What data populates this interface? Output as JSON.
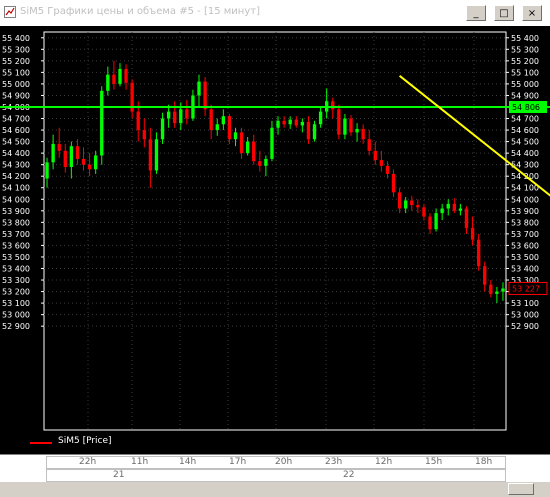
{
  "window": {
    "title": "SiM5 Графики цены и объема #5 - [15 минут]",
    "minimize_label": "_",
    "maximize_label": "□",
    "close_label": "×"
  },
  "chart_data": {
    "type": "candlestick",
    "instrument": "SiM5",
    "timeframe": "15 минут",
    "ylim": [
      52000,
      55450
    ],
    "y_ticks": [
      55400,
      55300,
      55200,
      55100,
      55000,
      54900,
      54800,
      54700,
      54600,
      54500,
      54400,
      54300,
      54200,
      54100,
      54000,
      53900,
      53800,
      53700,
      53600,
      53500,
      53400,
      53300,
      53200,
      53100,
      53000,
      52900
    ],
    "left_tick_labels": [
      "55 400",
      "55 300",
      "55 200",
      "55 100",
      "55 000",
      "54 900",
      "54 800",
      "54 700",
      "54 600",
      "54 500",
      "54 400",
      "54 300",
      "54 200",
      "54 100",
      "54 000",
      "53 900",
      "53 800",
      "53 700",
      "53 600",
      "53 500",
      "53 400",
      "53 300",
      "53 200",
      "53 100",
      "53 000",
      "52 900"
    ],
    "right_tick_labels": [
      "55 400",
      "55 300",
      "55 200",
      "55 100",
      "55 000",
      "54 900",
      "",
      "54 700",
      "54 600",
      "54 500",
      "54 400",
      "54 300",
      "54 200",
      "54 100",
      "54 000",
      "53 900",
      "53 800",
      "53 700",
      "53 600",
      "53 500",
      "53 400",
      "53 300",
      "",
      "53 100",
      "53 000",
      "52 900"
    ],
    "horizontal_level": {
      "value": 54800,
      "label": "54 806",
      "color": "#00ff00"
    },
    "last_price": {
      "value": 53227,
      "label": "53 227",
      "color": "#ff0000"
    },
    "trendline": {
      "from_index": 58,
      "from_value": 55070,
      "to_index": 90,
      "to_value": 53730,
      "color": "#ffff00"
    },
    "candles": [
      {
        "o": 54180,
        "h": 54360,
        "l": 54100,
        "c": 54320
      },
      {
        "o": 54320,
        "h": 54560,
        "l": 54260,
        "c": 54480
      },
      {
        "o": 54480,
        "h": 54620,
        "l": 54360,
        "c": 54420
      },
      {
        "o": 54420,
        "h": 54480,
        "l": 54230,
        "c": 54280
      },
      {
        "o": 54280,
        "h": 54500,
        "l": 54180,
        "c": 54460
      },
      {
        "o": 54460,
        "h": 54520,
        "l": 54300,
        "c": 54350
      },
      {
        "o": 54350,
        "h": 54450,
        "l": 54250,
        "c": 54300
      },
      {
        "o": 54300,
        "h": 54400,
        "l": 54200,
        "c": 54260
      },
      {
        "o": 54260,
        "h": 54420,
        "l": 54220,
        "c": 54380
      },
      {
        "o": 54380,
        "h": 54980,
        "l": 54300,
        "c": 54940
      },
      {
        "o": 54940,
        "h": 55150,
        "l": 54900,
        "c": 55080
      },
      {
        "o": 55080,
        "h": 55200,
        "l": 54950,
        "c": 55000
      },
      {
        "o": 55000,
        "h": 55180,
        "l": 54980,
        "c": 55130
      },
      {
        "o": 55130,
        "h": 55170,
        "l": 54950,
        "c": 55010
      },
      {
        "o": 55010,
        "h": 55040,
        "l": 54700,
        "c": 54760
      },
      {
        "o": 54760,
        "h": 54850,
        "l": 54500,
        "c": 54600
      },
      {
        "o": 54600,
        "h": 54700,
        "l": 54450,
        "c": 54520
      },
      {
        "o": 54520,
        "h": 54620,
        "l": 54100,
        "c": 54250
      },
      {
        "o": 54250,
        "h": 54580,
        "l": 54220,
        "c": 54520
      },
      {
        "o": 54520,
        "h": 54750,
        "l": 54480,
        "c": 54700
      },
      {
        "o": 54700,
        "h": 54820,
        "l": 54620,
        "c": 54760
      },
      {
        "o": 54760,
        "h": 54850,
        "l": 54620,
        "c": 54660
      },
      {
        "o": 54660,
        "h": 54840,
        "l": 54600,
        "c": 54780
      },
      {
        "o": 54780,
        "h": 54860,
        "l": 54650,
        "c": 54700
      },
      {
        "o": 54700,
        "h": 54950,
        "l": 54680,
        "c": 54900
      },
      {
        "o": 54900,
        "h": 55080,
        "l": 54800,
        "c": 55020
      },
      {
        "o": 55020,
        "h": 55060,
        "l": 54720,
        "c": 54780
      },
      {
        "o": 54780,
        "h": 54820,
        "l": 54520,
        "c": 54600
      },
      {
        "o": 54600,
        "h": 54700,
        "l": 54550,
        "c": 54650
      },
      {
        "o": 54650,
        "h": 54780,
        "l": 54600,
        "c": 54720
      },
      {
        "o": 54720,
        "h": 54740,
        "l": 54480,
        "c": 54520
      },
      {
        "o": 54520,
        "h": 54620,
        "l": 54460,
        "c": 54580
      },
      {
        "o": 54580,
        "h": 54620,
        "l": 54350,
        "c": 54400
      },
      {
        "o": 54400,
        "h": 54540,
        "l": 54380,
        "c": 54500
      },
      {
        "o": 54500,
        "h": 54560,
        "l": 54300,
        "c": 54330
      },
      {
        "o": 54330,
        "h": 54420,
        "l": 54240,
        "c": 54290
      },
      {
        "o": 54290,
        "h": 54380,
        "l": 54200,
        "c": 54350
      },
      {
        "o": 54350,
        "h": 54680,
        "l": 54330,
        "c": 54620
      },
      {
        "o": 54620,
        "h": 54720,
        "l": 54560,
        "c": 54680
      },
      {
        "o": 54680,
        "h": 54720,
        "l": 54620,
        "c": 54650
      },
      {
        "o": 54650,
        "h": 54720,
        "l": 54610,
        "c": 54690
      },
      {
        "o": 54690,
        "h": 54720,
        "l": 54620,
        "c": 54640
      },
      {
        "o": 54640,
        "h": 54700,
        "l": 54580,
        "c": 54670
      },
      {
        "o": 54670,
        "h": 54720,
        "l": 54480,
        "c": 54520
      },
      {
        "o": 54520,
        "h": 54680,
        "l": 54500,
        "c": 54650
      },
      {
        "o": 54650,
        "h": 54800,
        "l": 54620,
        "c": 54760
      },
      {
        "o": 54760,
        "h": 54960,
        "l": 54700,
        "c": 54850
      },
      {
        "o": 54850,
        "h": 54880,
        "l": 54700,
        "c": 54780
      },
      {
        "o": 54780,
        "h": 54820,
        "l": 54520,
        "c": 54560
      },
      {
        "o": 54560,
        "h": 54740,
        "l": 54520,
        "c": 54700
      },
      {
        "o": 54700,
        "h": 54730,
        "l": 54550,
        "c": 54580
      },
      {
        "o": 54580,
        "h": 54660,
        "l": 54500,
        "c": 54610
      },
      {
        "o": 54610,
        "h": 54650,
        "l": 54480,
        "c": 54520
      },
      {
        "o": 54520,
        "h": 54600,
        "l": 54380,
        "c": 54420
      },
      {
        "o": 54420,
        "h": 54500,
        "l": 54300,
        "c": 54340
      },
      {
        "o": 54340,
        "h": 54420,
        "l": 54240,
        "c": 54290
      },
      {
        "o": 54290,
        "h": 54330,
        "l": 54180,
        "c": 54220
      },
      {
        "o": 54220,
        "h": 54260,
        "l": 54020,
        "c": 54060
      },
      {
        "o": 54060,
        "h": 54100,
        "l": 53880,
        "c": 53920
      },
      {
        "o": 53920,
        "h": 54020,
        "l": 53880,
        "c": 53990
      },
      {
        "o": 53990,
        "h": 54030,
        "l": 53900,
        "c": 53950
      },
      {
        "o": 53950,
        "h": 54000,
        "l": 53880,
        "c": 53930
      },
      {
        "o": 53930,
        "h": 53960,
        "l": 53820,
        "c": 53850
      },
      {
        "o": 53850,
        "h": 53880,
        "l": 53700,
        "c": 53740
      },
      {
        "o": 53740,
        "h": 53920,
        "l": 53720,
        "c": 53880
      },
      {
        "o": 53880,
        "h": 53960,
        "l": 53820,
        "c": 53920
      },
      {
        "o": 53920,
        "h": 54000,
        "l": 53860,
        "c": 53960
      },
      {
        "o": 53960,
        "h": 54010,
        "l": 53880,
        "c": 53900
      },
      {
        "o": 53900,
        "h": 53960,
        "l": 53860,
        "c": 53920
      },
      {
        "o": 53920,
        "h": 53940,
        "l": 53700,
        "c": 53750
      },
      {
        "o": 53750,
        "h": 53850,
        "l": 53600,
        "c": 53650
      },
      {
        "o": 53650,
        "h": 53700,
        "l": 53380,
        "c": 53420
      },
      {
        "o": 53420,
        "h": 53460,
        "l": 53200,
        "c": 53260
      },
      {
        "o": 53260,
        "h": 53300,
        "l": 53150,
        "c": 53180
      },
      {
        "o": 53180,
        "h": 53240,
        "l": 53100,
        "c": 53200
      },
      {
        "o": 53200,
        "h": 53280,
        "l": 53120,
        "c": 53227
      }
    ],
    "x_ticks_row1": [
      "22h",
      "11h",
      "14h",
      "17h",
      "20h",
      "23h",
      "12h",
      "15h",
      "18h"
    ],
    "x_ticks_row2": [
      "21",
      "22"
    ],
    "legend": "SiM5 [Price]"
  }
}
